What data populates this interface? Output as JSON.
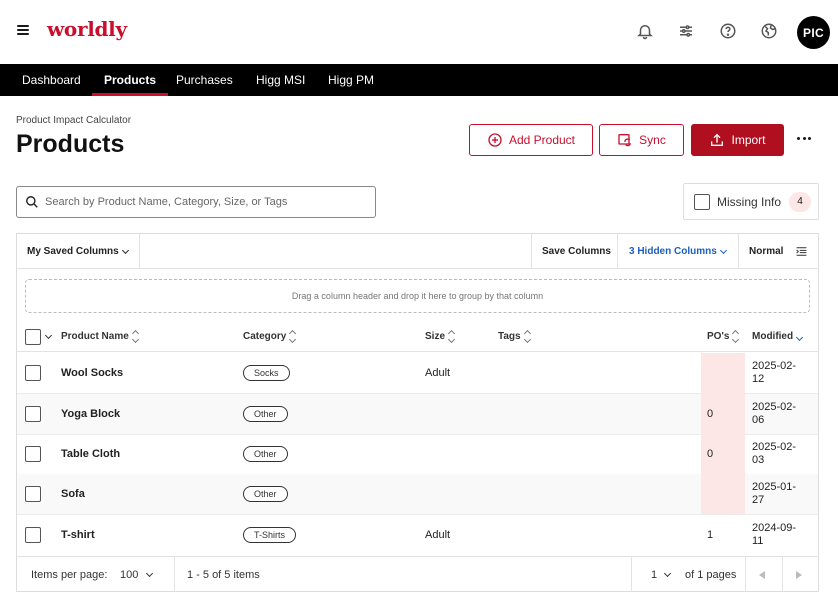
{
  "header": {
    "logo": "worldly",
    "avatar": "PIC",
    "icons": [
      "bell-icon",
      "sliders-icon",
      "help-icon",
      "globe-icon"
    ]
  },
  "nav": {
    "items": [
      "Dashboard",
      "Products",
      "Purchases",
      "Higg MSI",
      "Higg PM"
    ],
    "active": "Products"
  },
  "page": {
    "breadcrumb": "Product Impact Calculator",
    "title": "Products"
  },
  "actions": {
    "add_product": "Add Product",
    "sync": "Sync",
    "import": "Import"
  },
  "search": {
    "placeholder": "Search by Product Name, Category, Size, or Tags"
  },
  "filter": {
    "missing_info_label": "Missing Info",
    "missing_info_count": "4"
  },
  "grid_toolbar": {
    "saved_columns": "My Saved Columns",
    "save_columns": "Save Columns",
    "hidden_columns": "3 Hidden Columns",
    "density": "Normal"
  },
  "dropzone": "Drag a column header and drop it here to group by that column",
  "columns": {
    "name": "Product Name",
    "category": "Category",
    "size": "Size",
    "tags": "Tags",
    "pos": "PO's",
    "modified": "Modified"
  },
  "rows": [
    {
      "name": "Wool Socks",
      "category": "Socks",
      "size": "Adult",
      "tags": "",
      "pos": "",
      "modified_1": "2025-02-",
      "modified_2": "12"
    },
    {
      "name": "Yoga Block",
      "category": "Other",
      "size": "",
      "tags": "",
      "pos": "0",
      "modified_1": "2025-02-",
      "modified_2": "06"
    },
    {
      "name": "Table Cloth",
      "category": "Other",
      "size": "",
      "tags": "",
      "pos": "0",
      "modified_1": "2025-02-",
      "modified_2": "03"
    },
    {
      "name": "Sofa",
      "category": "Other",
      "size": "",
      "tags": "",
      "pos": "",
      "modified_1": "2025-01-",
      "modified_2": "27"
    },
    {
      "name": "T-shirt",
      "category": "T-Shirts",
      "size": "Adult",
      "tags": "",
      "pos": "1",
      "modified_1": "2024-09-",
      "modified_2": "11"
    }
  ],
  "footer": {
    "items_per_page_label": "Items per page:",
    "items_per_page": "100",
    "range": "1 - 5 of 5 items",
    "page": "1",
    "of_pages": "of 1 pages"
  },
  "colors": {
    "brand": "#c8102e",
    "primary_button": "#b00f1f",
    "link_blue": "#1b5fbd",
    "highlight": "#fde6e6"
  }
}
